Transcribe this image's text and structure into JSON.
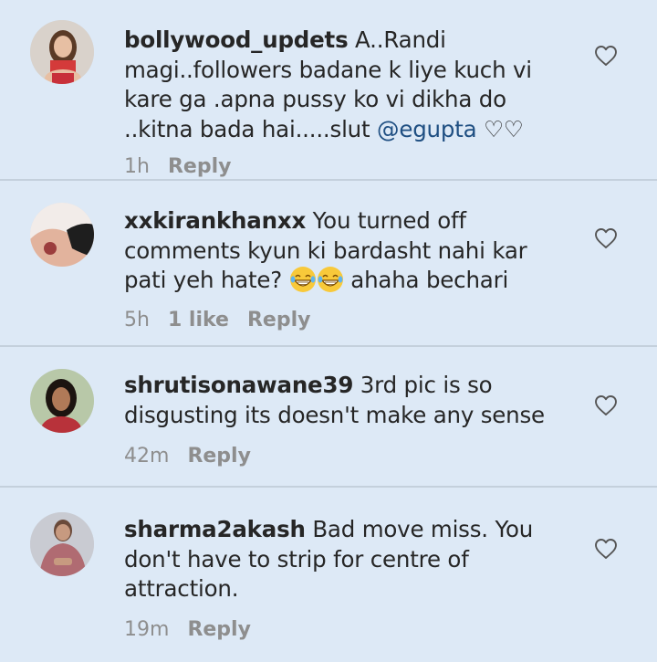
{
  "comments": [
    {
      "username": "bollywood_updets",
      "text": "A..Randi magi..followers badane  k liye  kuch vi kare ga .apna pussy ko vi dikha do ..kitna bada hai.....slut ",
      "mention": "@egupta",
      "suffix": " ♡♡",
      "time": "1h",
      "reply": "Reply"
    },
    {
      "username": "xxkirankhanxx",
      "text": "You turned off comments kyun ki bardasht nahi kar pati yeh hate? ",
      "after_emoji": " ahaha bechari",
      "emoji": [
        "grinning-tears-emoji",
        "grinning-tears-emoji"
      ],
      "time": "5h",
      "likes": "1 like",
      "reply": "Reply"
    },
    {
      "username": "shrutisonawane39",
      "text": "3rd pic is so disgusting its doesn't make any sense",
      "time": "42m",
      "reply": "Reply"
    },
    {
      "username": "sharma2akash",
      "text": "Bad move miss. You don't have to strip for centre of attraction.",
      "time": "19m",
      "reply": "Reply"
    }
  ],
  "colors": {
    "background": "#dde9f6",
    "text": "#262626",
    "meta": "#8e8e8e",
    "mention": "#1f4f82",
    "divider": "#c4d0dc"
  }
}
